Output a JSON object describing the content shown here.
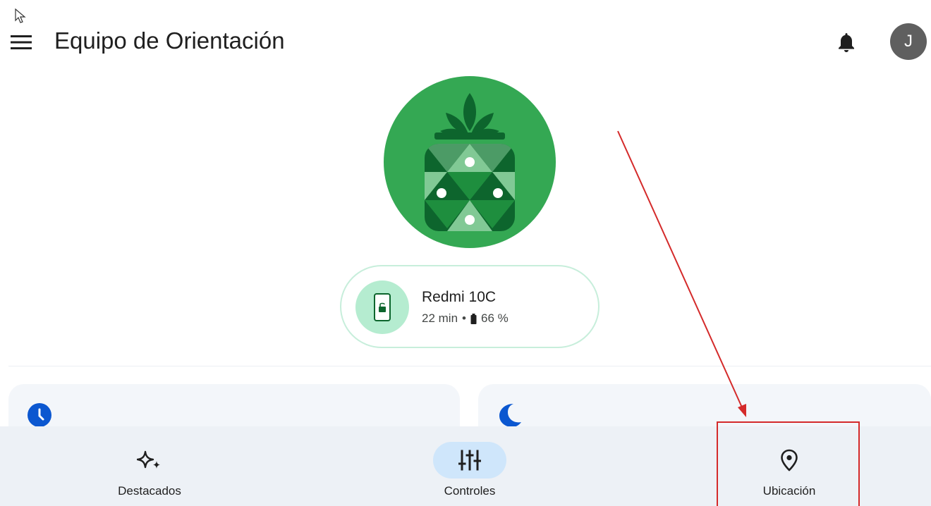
{
  "header": {
    "title": "Equipo de Orientación",
    "avatar_letter": "J"
  },
  "device": {
    "name": "Redmi 10C",
    "time": "22 min",
    "separator": "•",
    "battery": "66 %"
  },
  "bottom_nav": {
    "items": [
      {
        "label": "Destacados",
        "icon": "sparkle-icon",
        "active": false
      },
      {
        "label": "Controles",
        "icon": "tune-icon",
        "active": true
      },
      {
        "label": "Ubicación",
        "icon": "location-pin-icon",
        "active": false
      }
    ]
  },
  "colors": {
    "logo_green": "#34a853",
    "logo_dark_green": "#0d652d",
    "logo_light_green": "#81c995",
    "nav_background": "#edf1f6",
    "active_pill": "#cfe6fb",
    "annotation_red": "#d42a2a",
    "card_icon_blue": "#0b57d0"
  }
}
